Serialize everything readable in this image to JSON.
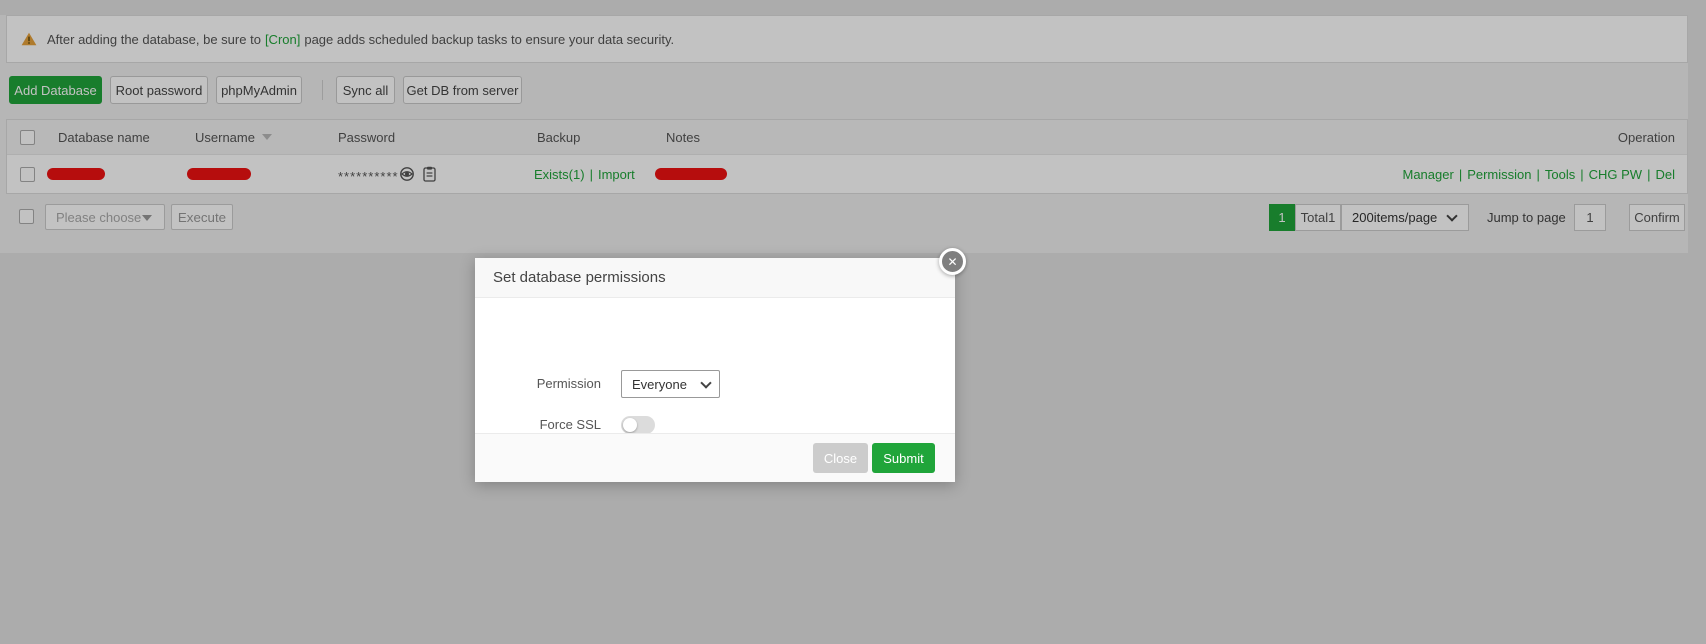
{
  "banner": {
    "text_before": "After adding the database, be sure to",
    "link": "[Cron]",
    "text_after": "page adds scheduled backup tasks to ensure your data security."
  },
  "toolbar": {
    "add_database": "Add Database",
    "root_password": "Root password",
    "phpmyadmin": "phpMyAdmin",
    "sync_all": "Sync all",
    "get_db_from_server": "Get DB from server"
  },
  "table": {
    "headers": {
      "database_name": "Database name",
      "username": "Username",
      "password": "Password",
      "backup": "Backup",
      "notes": "Notes",
      "operation": "Operation"
    },
    "row": {
      "password_mask": "**********",
      "backup_links": [
        "Exists(1)",
        "Import"
      ],
      "operation_links": [
        "Manager",
        "Permission",
        "Tools",
        "CHG PW",
        "Del"
      ]
    },
    "separator": "|"
  },
  "bulkbar": {
    "please_choose": "Please choose",
    "execute": "Execute"
  },
  "pagination": {
    "current_page": "1",
    "total": "Total1",
    "per_page": "200items/page",
    "jump_label": "Jump to page",
    "jump_value": "1",
    "confirm": "Confirm"
  },
  "modal": {
    "title": "Set database permissions",
    "close_icon": "✕",
    "permission_label": "Permission",
    "permission_value": "Everyone",
    "force_ssl_label": "Force SSL",
    "close_button": "Close",
    "submit_button": "Submit"
  },
  "colors": {
    "accent_green": "#20a53a",
    "redaction_red": "#f01212",
    "warning_orange": "#e6a23c"
  }
}
